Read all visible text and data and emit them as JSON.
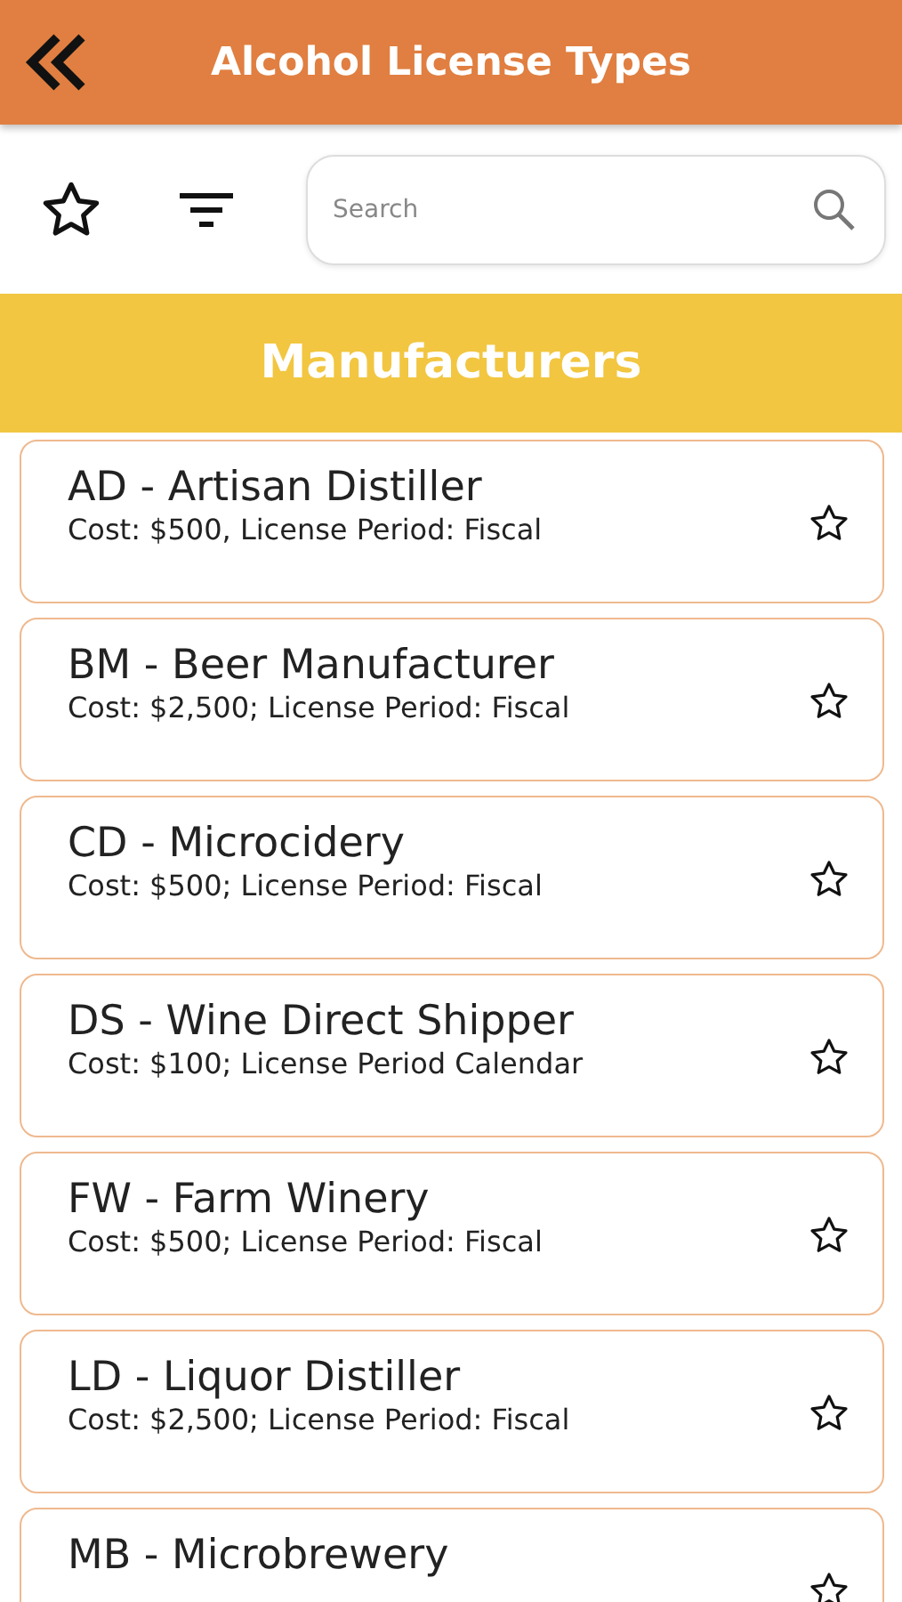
{
  "header": {
    "title": "Alcohol License Types"
  },
  "search": {
    "placeholder": "Search"
  },
  "section": {
    "title": "Manufacturers"
  },
  "licenses": [
    {
      "title": "AD - Artisan Distiller",
      "detail": "Cost: $500, License Period: Fiscal",
      "favorite": false
    },
    {
      "title": "BM - Beer Manufacturer",
      "detail": "Cost: $2,500; License Period: Fiscal",
      "favorite": false
    },
    {
      "title": "CD - Microcidery",
      "detail": "Cost: $500; License Period: Fiscal",
      "favorite": false
    },
    {
      "title": "DS - Wine Direct Shipper",
      "detail": "Cost: $100; License Period Calendar",
      "favorite": false
    },
    {
      "title": "FW - Farm Winery",
      "detail": "Cost: $500; License Period: Fiscal",
      "favorite": false
    },
    {
      "title": "LD - Liquor Distiller",
      "detail": "Cost: $2,500; License Period: Fiscal",
      "favorite": false
    },
    {
      "title": "MB - Microbrewery",
      "favorite": false
    }
  ]
}
